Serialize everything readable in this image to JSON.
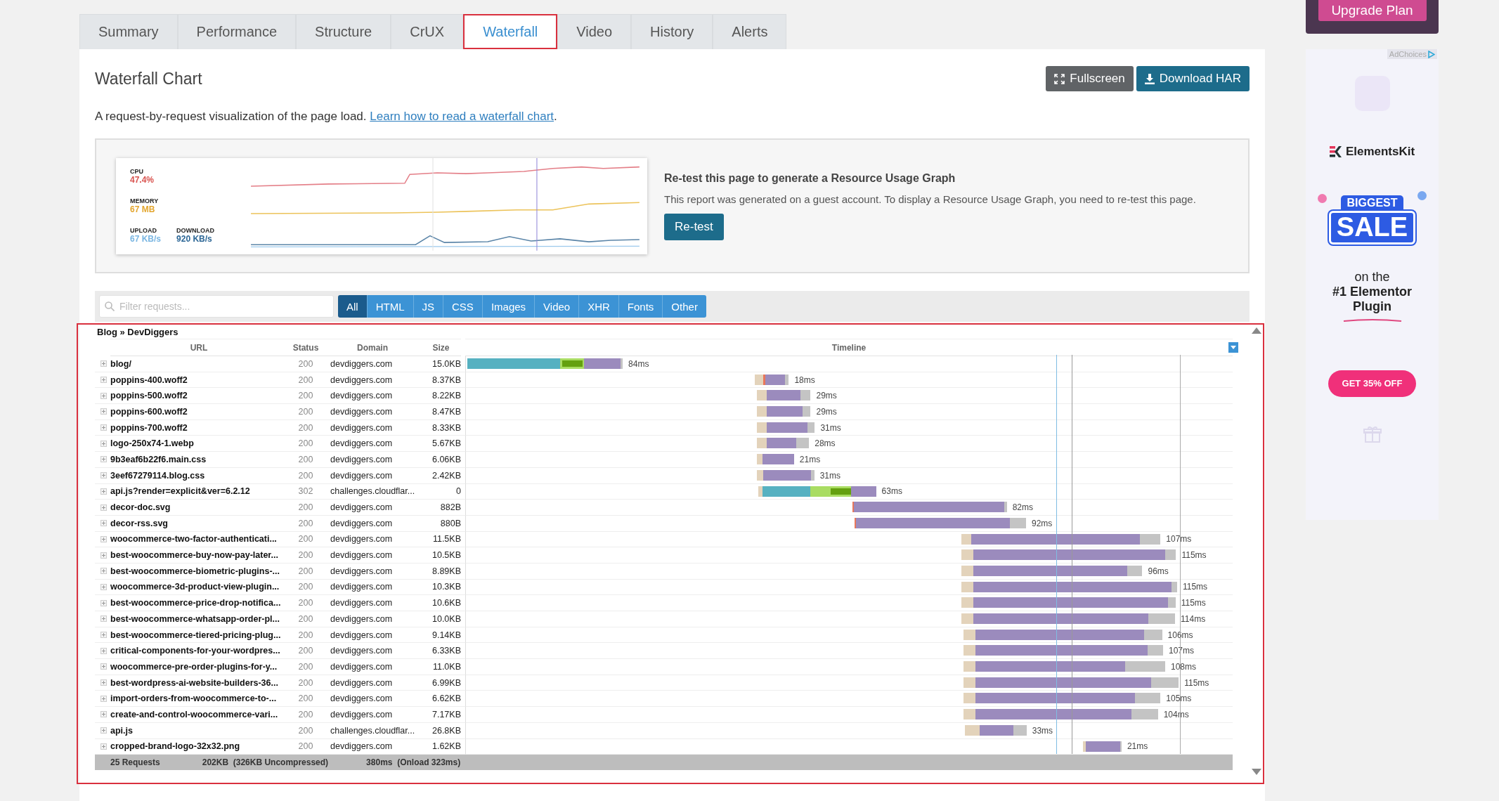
{
  "tabs": [
    {
      "label": "Summary",
      "selected": false
    },
    {
      "label": "Performance",
      "selected": false
    },
    {
      "label": "Structure",
      "selected": false
    },
    {
      "label": "CrUX",
      "selected": false
    },
    {
      "label": "Waterfall",
      "selected": true
    },
    {
      "label": "Video",
      "selected": false
    },
    {
      "label": "History",
      "selected": false
    },
    {
      "label": "Alerts",
      "selected": false
    }
  ],
  "header": {
    "title": "Waterfall Chart",
    "buttons": [
      {
        "label": "Fullscreen",
        "kind": "fullscreen"
      },
      {
        "label": "Download HAR",
        "kind": "download"
      }
    ],
    "description": {
      "text": "A request-by-request visualization of the page load.",
      "link": "Learn how to read a waterfall chart",
      "after": "."
    }
  },
  "resource_graph": {
    "metrics": [
      {
        "label": "CPU",
        "value": "47.4%",
        "color": "#d9534f"
      },
      {
        "label": "MEMORY",
        "value": "67 MB",
        "color": "#e3a62f"
      },
      {
        "label": "UPLOAD",
        "value": "67 KB/s",
        "color": "#7ab6e2"
      },
      {
        "label": "DOWNLOAD",
        "value": "920 KB/s",
        "color": "#2d6796"
      }
    ],
    "heading": "Re-test this page to generate a Resource Usage Graph",
    "message": "This report was generated on a guest account. To display a Resource Usage Graph, you need to re-test this page.",
    "button": "Re-test"
  },
  "filter": {
    "placeholder": "Filter requests...",
    "types": [
      {
        "label": "All",
        "selected": true
      },
      {
        "label": "HTML",
        "selected": false
      },
      {
        "label": "JS",
        "selected": false
      },
      {
        "label": "CSS",
        "selected": false
      },
      {
        "label": "Images",
        "selected": false
      },
      {
        "label": "Video",
        "selected": false
      },
      {
        "label": "XHR",
        "selected": false
      },
      {
        "label": "Fonts",
        "selected": false
      },
      {
        "label": "Other",
        "selected": false
      }
    ]
  },
  "waterfall": {
    "breadcrumb": "Blog » DevDiggers",
    "columns": [
      "URL",
      "Status",
      "Domain",
      "Size",
      "Timeline"
    ],
    "rows": [
      {
        "url": "blog/",
        "status": "200",
        "domain": "devdiggers.com",
        "size": "15.0KB",
        "duration": "84ms"
      },
      {
        "url": "poppins-400.woff2",
        "status": "200",
        "domain": "devdiggers.com",
        "size": "8.37KB",
        "duration": "18ms"
      },
      {
        "url": "poppins-500.woff2",
        "status": "200",
        "domain": "devdiggers.com",
        "size": "8.22KB",
        "duration": "29ms"
      },
      {
        "url": "poppins-600.woff2",
        "status": "200",
        "domain": "devdiggers.com",
        "size": "8.47KB",
        "duration": "29ms"
      },
      {
        "url": "poppins-700.woff2",
        "status": "200",
        "domain": "devdiggers.com",
        "size": "8.33KB",
        "duration": "31ms"
      },
      {
        "url": "logo-250x74-1.webp",
        "status": "200",
        "domain": "devdiggers.com",
        "size": "5.67KB",
        "duration": "28ms"
      },
      {
        "url": "9b3eaf6b22f6.main.css",
        "status": "200",
        "domain": "devdiggers.com",
        "size": "6.06KB",
        "duration": "21ms"
      },
      {
        "url": "3eef67279114.blog.css",
        "status": "200",
        "domain": "devdiggers.com",
        "size": "2.42KB",
        "duration": "31ms"
      },
      {
        "url": "api.js?render=explicit&ver=6.2.12",
        "status": "302",
        "domain": "challenges.cloudflar...",
        "size": "0",
        "duration": "63ms"
      },
      {
        "url": "decor-doc.svg",
        "status": "200",
        "domain": "devdiggers.com",
        "size": "882B",
        "duration": "82ms"
      },
      {
        "url": "decor-rss.svg",
        "status": "200",
        "domain": "devdiggers.com",
        "size": "880B",
        "duration": "92ms"
      },
      {
        "url": "woocommerce-two-factor-authenticati...",
        "status": "200",
        "domain": "devdiggers.com",
        "size": "11.5KB",
        "duration": "107ms"
      },
      {
        "url": "best-woocommerce-buy-now-pay-later...",
        "status": "200",
        "domain": "devdiggers.com",
        "size": "10.5KB",
        "duration": "115ms"
      },
      {
        "url": "best-woocommerce-biometric-plugins-...",
        "status": "200",
        "domain": "devdiggers.com",
        "size": "8.89KB",
        "duration": "96ms"
      },
      {
        "url": "woocommerce-3d-product-view-plugin...",
        "status": "200",
        "domain": "devdiggers.com",
        "size": "10.3KB",
        "duration": "115ms"
      },
      {
        "url": "best-woocommerce-price-drop-notifica...",
        "status": "200",
        "domain": "devdiggers.com",
        "size": "10.6KB",
        "duration": "115ms"
      },
      {
        "url": "best-woocommerce-whatsapp-order-pl...",
        "status": "200",
        "domain": "devdiggers.com",
        "size": "10.0KB",
        "duration": "114ms"
      },
      {
        "url": "best-woocommerce-tiered-pricing-plug...",
        "status": "200",
        "domain": "devdiggers.com",
        "size": "9.14KB",
        "duration": "106ms"
      },
      {
        "url": "critical-components-for-your-wordpres...",
        "status": "200",
        "domain": "devdiggers.com",
        "size": "6.33KB",
        "duration": "107ms"
      },
      {
        "url": "woocommerce-pre-order-plugins-for-y...",
        "status": "200",
        "domain": "devdiggers.com",
        "size": "11.0KB",
        "duration": "108ms"
      },
      {
        "url": "best-wordpress-ai-website-builders-36...",
        "status": "200",
        "domain": "devdiggers.com",
        "size": "6.99KB",
        "duration": "115ms"
      },
      {
        "url": "import-orders-from-woocommerce-to-...",
        "status": "200",
        "domain": "devdiggers.com",
        "size": "6.62KB",
        "duration": "105ms"
      },
      {
        "url": "create-and-control-woocommerce-vari...",
        "status": "200",
        "domain": "devdiggers.com",
        "size": "7.17KB",
        "duration": "104ms"
      },
      {
        "url": "api.js",
        "status": "200",
        "domain": "challenges.cloudflar...",
        "size": "26.8KB",
        "duration": "33ms"
      },
      {
        "url": "cropped-brand-logo-32x32.png",
        "status": "200",
        "domain": "devdiggers.com",
        "size": "1.62KB",
        "duration": "21ms"
      }
    ],
    "footer": {
      "requests": "25 Requests",
      "size": "202KB  (326KB Uncompressed)",
      "time": "380ms  (Onload 323ms)"
    }
  },
  "sidebar": {
    "upgrade": "Upgrade Plan",
    "ad": {
      "adchoices": "AdChoices",
      "brand": "ElementsKit",
      "badge_top": "BIGGEST",
      "badge_main": "SALE",
      "line1": "on the",
      "line2": "#1 Elementor",
      "line3": "Plugin",
      "cta": "GET 35% OFF"
    }
  }
}
